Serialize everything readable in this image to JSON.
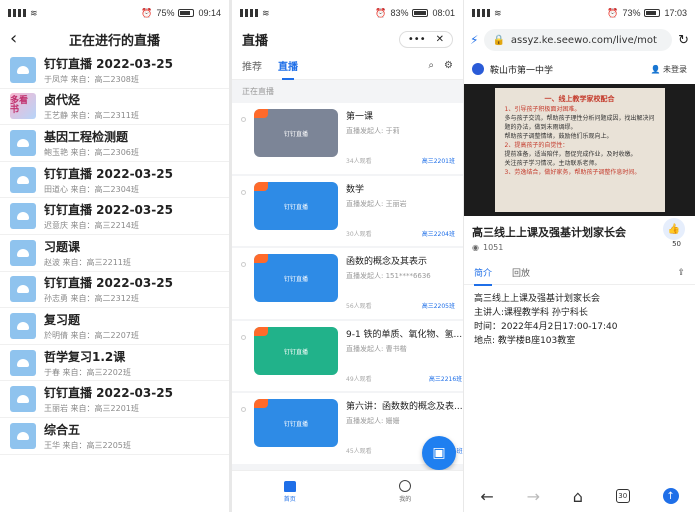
{
  "panel1": {
    "status": {
      "battery": "75%",
      "time": "09:14"
    },
    "title": "正在进行的直播",
    "items": [
      {
        "title": "钉钉直播 2022-03-25",
        "sub": "于凤萍  来自：高二2308班",
        "thumb": "cloud"
      },
      {
        "title": "卤代烃",
        "sub": "王艺静  来自：高二2311班",
        "thumb": "image",
        "thumb_text": "多看 书"
      },
      {
        "title": "基因工程检测题",
        "sub": "鲍玉艳  来自：高二2306班",
        "thumb": "cloud"
      },
      {
        "title": "钉钉直播 2022-03-25",
        "sub": "田道心  来自：高二2304班",
        "thumb": "cloud"
      },
      {
        "title": "钉钉直播 2022-03-25",
        "sub": "迟意庆  来自：高三2214班",
        "thumb": "cloud"
      },
      {
        "title": "习题课",
        "sub": "赵波  来自：高三2211班",
        "thumb": "cloud"
      },
      {
        "title": "钉钉直播 2022-03-25",
        "sub": "孙志勇  来自：高二2312班",
        "thumb": "cloud"
      },
      {
        "title": "复习题",
        "sub": "於明倩  来自：高二2207班",
        "thumb": "cloud"
      },
      {
        "title": "哲学复习1.2课",
        "sub": "于春  来自：高三2202班",
        "thumb": "cloud"
      },
      {
        "title": "钉钉直播 2022-03-25",
        "sub": "王丽岩  来自：高三2201班",
        "thumb": "cloud"
      },
      {
        "title": "综合五",
        "sub": "王华  来自：高三2205班",
        "thumb": "cloud"
      }
    ]
  },
  "panel2": {
    "status": {
      "battery": "83%",
      "time": "08:01"
    },
    "title": "直播",
    "capsule_more": "•••",
    "capsule_close": "✕",
    "tabs": [
      "推荐",
      "直播"
    ],
    "section_label": "正在直播",
    "thumb_label": "钉钉直播",
    "cards": [
      {
        "title": "第一课",
        "by": "直播发起人: 于莉",
        "views": "34人观看",
        "class": "高三2201班",
        "color": "#7c8597"
      },
      {
        "title": "数学",
        "by": "直播发起人: 王丽岩",
        "views": "30人观看",
        "class": "高三2204班",
        "color": "#2e8be6"
      },
      {
        "title": "函数的概念及其表示",
        "by": "直播发起人: 151****6636",
        "views": "56人观看",
        "class": "高三2205班",
        "color": "#2e8be6"
      },
      {
        "title": "9-1 铁的单质、氧化物、氢...",
        "by": "直播发起人: 曹书楷",
        "views": "49人观看",
        "class": "高三2216班",
        "color": "#21b28a"
      },
      {
        "title": "第六讲：函数数的概念及表...",
        "by": "直播发起人: 姗姗",
        "views": "45人观看",
        "class": "高三2206班",
        "color": "#2e8be6"
      }
    ],
    "nav": [
      {
        "label": "首页"
      },
      {
        "label": "我的"
      }
    ]
  },
  "panel3": {
    "status": {
      "battery": "73%",
      "time": "17:03"
    },
    "url": "assyz.ke.seewo.com/live/mot",
    "site_name": "鞍山市第一中学",
    "login": "未登录",
    "slide": {
      "heading": "一、线上教学家校配合",
      "lines": [
        "1、引导孩子积极面对困难。",
        "多与孩子交流，帮助孩子理性分析问题成因，找出解决问题的办法，做到未雨绸缪。",
        "帮助孩子调整情绪，鼓励他们乐观向上。",
        "2、提高孩子的自觉性：",
        "提前准备，适当陪伴，督促完成作业，及时收缴。",
        "关注孩子学习情况，主动联系老师。",
        "3、劳逸结合，做好家务，帮助孩子调整作息时间。"
      ]
    },
    "course_title": "高三线上上课及强基计划家长会",
    "views": "1051",
    "likes": "50",
    "tabs": [
      "简介",
      "回放"
    ],
    "details": {
      "title": "高三线上上课及强基计划家长会",
      "speaker": "主讲人:课程教学科 孙宁科长",
      "time": "时间：2022年4月2日17:00-17:40",
      "place": "地点: 教学楼B座103教室"
    },
    "tab_count": "30"
  }
}
